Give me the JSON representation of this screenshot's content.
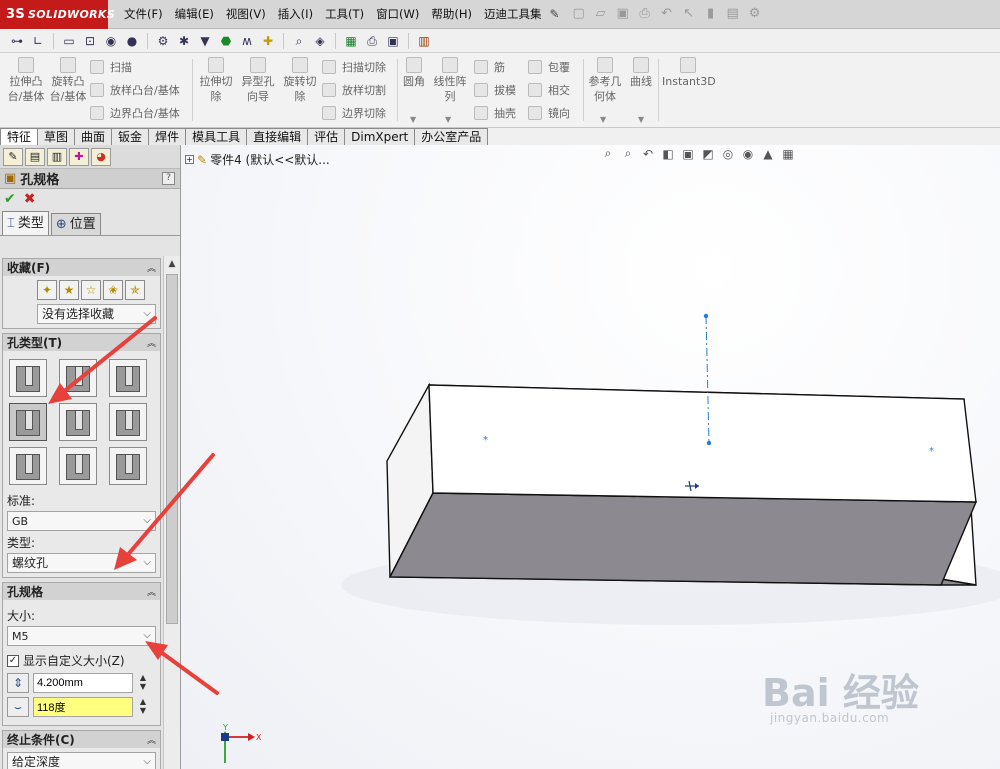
{
  "app": {
    "logo_prefix": "3S",
    "logo_text": "SOLIDWORKS"
  },
  "menu": [
    "文件(F)",
    "编辑(E)",
    "视图(V)",
    "插入(I)",
    "工具(T)",
    "窗口(W)",
    "帮助(H)",
    "迈迪工具集"
  ],
  "quick_access_icons": [
    "new-icon",
    "open-icon",
    "save-icon",
    "print-icon",
    "undo-icon",
    "select-icon",
    "rebuild-icon",
    "file-props-icon",
    "options-icon"
  ],
  "toolbar2_icons": [
    "icon-1",
    "icon-2",
    "icon-3",
    "icon-4",
    "icon-5",
    "icon-6",
    "icon-7",
    "icon-8",
    "icon-9",
    "icon-10",
    "icon-11",
    "icon-12",
    "icon-13",
    "icon-14",
    "icon-15",
    "icon-16",
    "icon-17"
  ],
  "ribbon": {
    "extrude_boss": "拉伸凸台/基体",
    "revolve_boss": "旋转凸台/基体",
    "sweep": "扫描",
    "loft_boss": "放样凸台/基体",
    "boundary_boss": "边界凸台/基体",
    "extrude_cut": "拉伸切除",
    "hole_wizard": "异型孔向导",
    "revolve_cut": "旋转切除",
    "sweep_cut": "扫描切除",
    "loft_cut": "放样切割",
    "boundary_cut": "边界切除",
    "fillet": "圆角",
    "linear_pattern": "线性阵列",
    "rib": "筋",
    "draft": "拔模",
    "shell": "抽壳",
    "wrap": "包覆",
    "intersect": "相交",
    "mirror": "镜向",
    "ref_geometry": "参考几何体",
    "curves": "曲线",
    "instant3d": "Instant3D"
  },
  "tabs": [
    "特征",
    "草图",
    "曲面",
    "钣金",
    "焊件",
    "模具工具",
    "直接编辑",
    "评估",
    "DimXpert",
    "办公室产品"
  ],
  "active_tab": "特征",
  "panel": {
    "title": "孔规格",
    "help": "?",
    "ok": "✔",
    "cancel": "✖",
    "subtab_type": "类型",
    "subtab_position": "位置",
    "favorites": {
      "header": "收藏(F)",
      "select_value": "没有选择收藏"
    },
    "hole_type": {
      "header": "孔类型(T)",
      "standard_label": "标准:",
      "standard_value": "GB",
      "type_label": "类型:",
      "type_value": "螺纹孔"
    },
    "hole_spec": {
      "header": "孔规格",
      "size_label": "大小:",
      "size_value": "M5",
      "custom_size_label": "显示自定义大小(Z)",
      "diameter_value": "4.200mm",
      "angle_value": "118度"
    },
    "end_condition": {
      "header": "终止条件(C)",
      "value": "给定深度"
    }
  },
  "tree": {
    "part_label": "零件4  (默认<<默认..."
  },
  "watermark": {
    "main": "Bai 经验",
    "sub": "jingyan.baidu.com"
  },
  "colors": {
    "logo_red": "#c41a1a",
    "accept_green": "#2a9a2a",
    "cancel_red": "#cc1f1f",
    "arrow_red": "#e8403a",
    "highlight_yellow": "#ffff80"
  }
}
